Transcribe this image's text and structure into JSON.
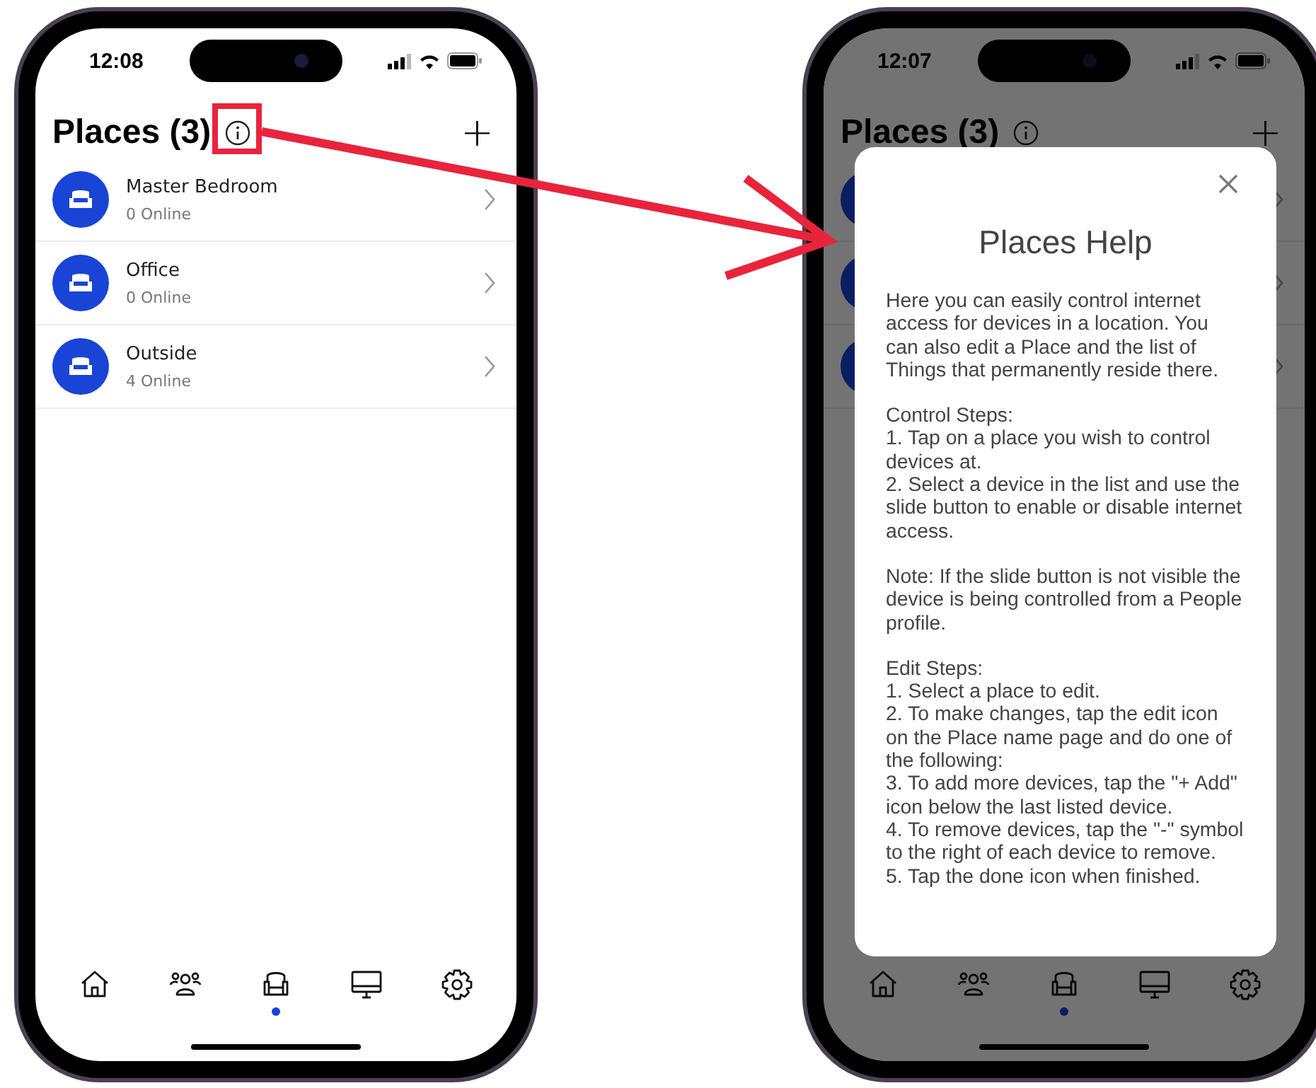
{
  "phones": [
    {
      "time": "12:08",
      "title": "Places (3)",
      "add_label": "+",
      "places": [
        {
          "kind": "place",
          "name": "Master Bedroom",
          "status": "0 Online"
        },
        {
          "kind": "place",
          "name": "Office",
          "status": "0 Online"
        },
        {
          "kind": "place",
          "name": "Outside",
          "status": "4 Online"
        }
      ],
      "nav": [
        {
          "kind": "home",
          "selected": false
        },
        {
          "kind": "people",
          "selected": false
        },
        {
          "kind": "places",
          "selected": true
        },
        {
          "kind": "devices",
          "selected": false
        },
        {
          "kind": "settings",
          "selected": false
        }
      ]
    },
    {
      "time": "12:07",
      "title": "Places (3)",
      "add_label": "+",
      "places": [
        {
          "kind": "covered"
        },
        {
          "kind": "covered"
        },
        {
          "kind": "covered"
        }
      ],
      "nav": [
        {
          "kind": "home",
          "selected": false
        },
        {
          "kind": "people",
          "selected": false
        },
        {
          "kind": "places",
          "selected": true
        },
        {
          "kind": "devices",
          "selected": false
        },
        {
          "kind": "settings",
          "selected": false
        }
      ],
      "dialog": {
        "title": "Places Help",
        "sections": [
          {
            "lines": [
              "Here you can easily control internet access for devices in a location. You can also edit a Place and the list of Things that permanently reside there."
            ]
          },
          {
            "lines": [
              "Control Steps:",
              "1. Tap on a place you wish to control devices at.",
              "2. Select a device in the list and use the slide button to enable or disable internet access."
            ]
          },
          {
            "lines": [
              "Note: If the slide button is not visible the device is being controlled from a People profile."
            ]
          },
          {
            "lines": [
              "Edit Steps:",
              "1. Select a place to edit.",
              "2. To make changes, tap the edit icon on the Place name page and do one of the following:",
              "3. To add more devices, tap the \"+ Add\" icon below the last listed device.",
              "4. To remove devices, tap the \"-\" symbol to the right of each device to remove.",
              "5. Tap the done icon when finished."
            ]
          }
        ]
      }
    }
  ]
}
